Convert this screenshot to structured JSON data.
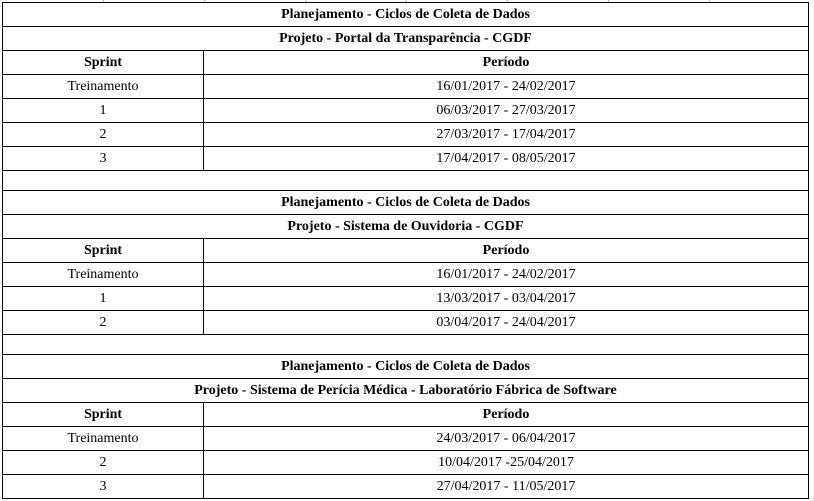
{
  "sections": [
    {
      "title": "Planejamento - Ciclos de Coleta de Dados",
      "project": "Projeto - Portal da Transparência - CGDF",
      "header": {
        "sprint": "Sprint",
        "period": "Período"
      },
      "rows": [
        {
          "sprint": "Treinamento",
          "period": "16/01/2017 - 24/02/2017"
        },
        {
          "sprint": "1",
          "period": "06/03/2017 - 27/03/2017"
        },
        {
          "sprint": "2",
          "period": "27/03/2017 - 17/04/2017"
        },
        {
          "sprint": "3",
          "period": "17/04/2017 - 08/05/2017"
        }
      ]
    },
    {
      "title": "Planejamento - Ciclos de Coleta de Dados",
      "project": "Projeto - Sistema de Ouvidoria - CGDF",
      "header": {
        "sprint": "Sprint",
        "period": "Período"
      },
      "rows": [
        {
          "sprint": "Treinamento",
          "period": "16/01/2017 - 24/02/2017"
        },
        {
          "sprint": "1",
          "period": "13/03/2017 - 03/04/2017"
        },
        {
          "sprint": "2",
          "period": "03/04/2017 - 24/04/2017"
        }
      ]
    },
    {
      "title": "Planejamento - Ciclos de Coleta de Dados",
      "project": "Projeto - Sistema de Perícia Médica - Laboratório Fábrica de Software",
      "header": {
        "sprint": "Sprint",
        "period": "Período"
      },
      "rows": [
        {
          "sprint": "Treinamento",
          "period": "24/03/2017 - 06/04/2017"
        },
        {
          "sprint": "2",
          "period": "10/04/2017 -25/04/2017"
        },
        {
          "sprint": "3",
          "period": "27/04/2017 - 11/05/2017"
        }
      ]
    }
  ]
}
